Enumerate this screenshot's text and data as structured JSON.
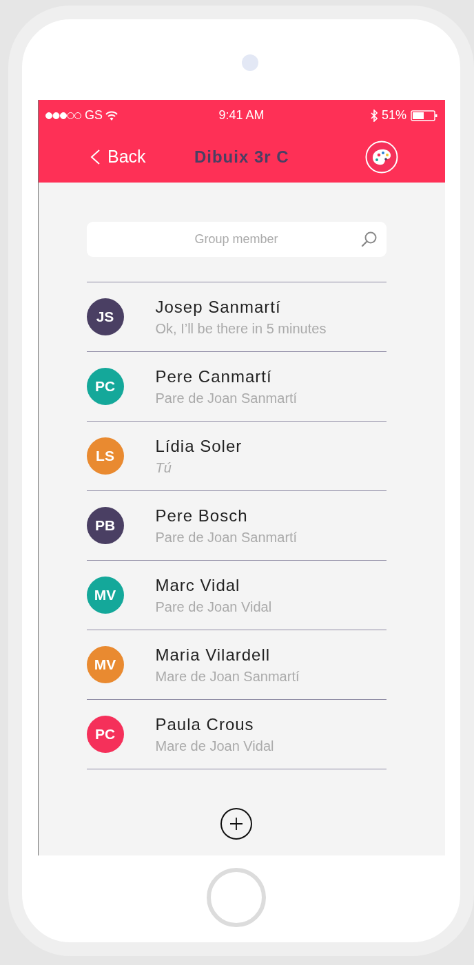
{
  "status_bar": {
    "carrier": "GS",
    "time": "9:41 AM",
    "battery": "51%"
  },
  "nav_bar": {
    "back": "Back",
    "title": "Dibuix 3r C"
  },
  "search": {
    "placeholder": "Group member"
  },
  "members": [
    {
      "initials": "JS",
      "name": "Josep Sanmartí",
      "subtitle": "Ok, I’ll be there in 5 minutes",
      "color": "#4a3f63",
      "is_you": false
    },
    {
      "initials": "PC",
      "name": "Pere Canmartí",
      "subtitle": "Pare de Joan Sanmartí",
      "color": "#14a89a",
      "is_you": false
    },
    {
      "initials": "LS",
      "name": "Lídia Soler",
      "subtitle": "Tú",
      "color": "#e98a30",
      "is_you": true
    },
    {
      "initials": "PB",
      "name": "Pere Bosch",
      "subtitle": "Pare de Joan Sanmartí",
      "color": "#4a3f63",
      "is_you": false
    },
    {
      "initials": "MV",
      "name": "Marc Vidal",
      "subtitle": "Pare de Joan Vidal",
      "color": "#14a89a",
      "is_you": false
    },
    {
      "initials": "MV",
      "name": "Maria Vilardell",
      "subtitle": "Mare de Joan Sanmartí",
      "color": "#e98a30",
      "is_you": false
    },
    {
      "initials": "PC",
      "name": "Paula Crous",
      "subtitle": "Mare de Joan Vidal",
      "color": "#f5305a",
      "is_you": false
    }
  ]
}
